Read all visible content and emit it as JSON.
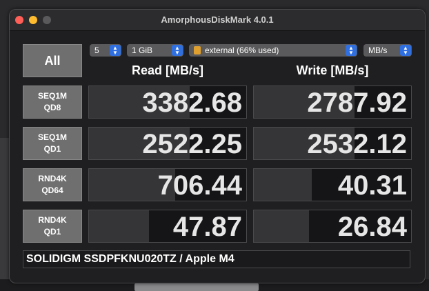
{
  "app": {
    "title": "AmorphousDiskMark 4.0.1"
  },
  "controls": {
    "all_label": "All",
    "count": "5",
    "size": "1 GiB",
    "drive": "external (66% used)",
    "unit": "MB/s"
  },
  "headers": {
    "read": "Read [MB/s]",
    "write": "Write [MB/s]"
  },
  "rows": [
    {
      "label1": "SEQ1M",
      "label2": "QD8",
      "read": "3382.68",
      "write": "2787.92",
      "read_fill": 0.64,
      "write_fill": 0.64
    },
    {
      "label1": "SEQ1M",
      "label2": "QD1",
      "read": "2522.25",
      "write": "2532.12",
      "read_fill": 0.64,
      "write_fill": 0.64
    },
    {
      "label1": "RND4K",
      "label2": "QD64",
      "read": "706.44",
      "write": "40.31",
      "read_fill": 0.55,
      "write_fill": 0.37
    },
    {
      "label1": "RND4K",
      "label2": "QD1",
      "read": "47.87",
      "write": "26.84",
      "read_fill": 0.38,
      "write_fill": 0.35
    }
  ],
  "footer": {
    "device": "SOLIDIGM SSDPFKNU020TZ / Apple M4"
  },
  "colors": {
    "close": "#ff5f57",
    "minimize": "#febc2e",
    "accent": "#2f6fe0"
  }
}
